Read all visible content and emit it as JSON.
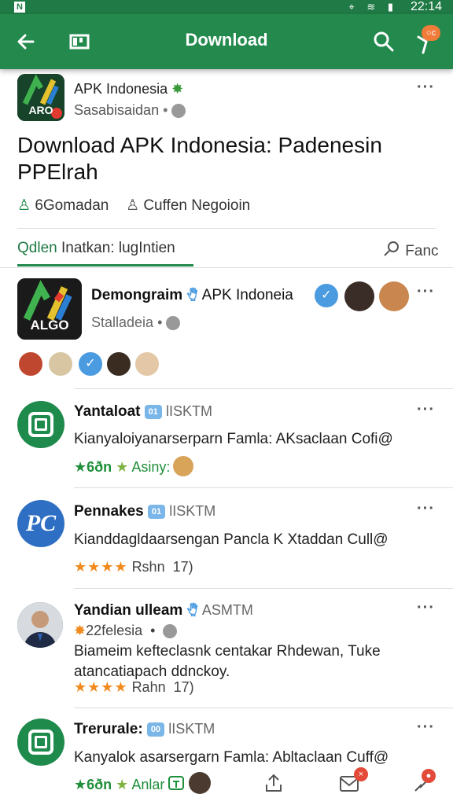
{
  "status_bar": {
    "time": "22:14"
  },
  "app_bar": {
    "title": "Download",
    "notification_badge": "○c"
  },
  "header": {
    "logo_text": "ARO",
    "name": "APK Indonesia",
    "subtitle": "Sasabisaidan",
    "title": "Download APK Indonesia: Padenesin PPElrah",
    "meta_1": "6Gomadan",
    "meta_2": "Cuffen Negoioin"
  },
  "tabs": {
    "active": "Qdlen",
    "active_rest": "Inatkan: lugIntien",
    "search_label": "Fanc"
  },
  "featured": {
    "logo_text": "ALGO",
    "name": "Demongraim",
    "channel": "APK Indoneia",
    "subtitle": "Stalladeia"
  },
  "posts": [
    {
      "name": "Yantaloat",
      "tag": "01",
      "handle": "ƖISKTM",
      "body": "Kianyaloiyanarserparn Famla: AKsaclaan Cofi@",
      "rating_text": "6ðn",
      "extra": "Asiny:"
    },
    {
      "name": "Pennakes",
      "tag": "01",
      "handle": "ƖISKTM",
      "avatar_text": "PC",
      "body": "Kianddagldaarsengan Pancla  K Xtaddan Cull@",
      "stars": "★★★★",
      "extra": "Rshn",
      "count": "17)"
    },
    {
      "name": "Yandian ulleam",
      "handle": "ASMTM",
      "subline": "22felesia",
      "body": "Biameim kefteclasnk centakar Rhdewan, Tuke atancatiapach ddnckoy.",
      "stars": "★★★★",
      "extra": "Rahn",
      "count": "17)"
    },
    {
      "name": "Trerurale:",
      "tag": "00",
      "handle": "ƖISKTM",
      "body": "Kanyalok asarsergarn Famla: Abltaclaan Cuff@",
      "rating_text": "6ðn",
      "extra": "Anlar"
    }
  ],
  "colors": {
    "brand_green": "#23894d",
    "star_orange": "#f08a1e",
    "verified_blue": "#4a9be0"
  }
}
